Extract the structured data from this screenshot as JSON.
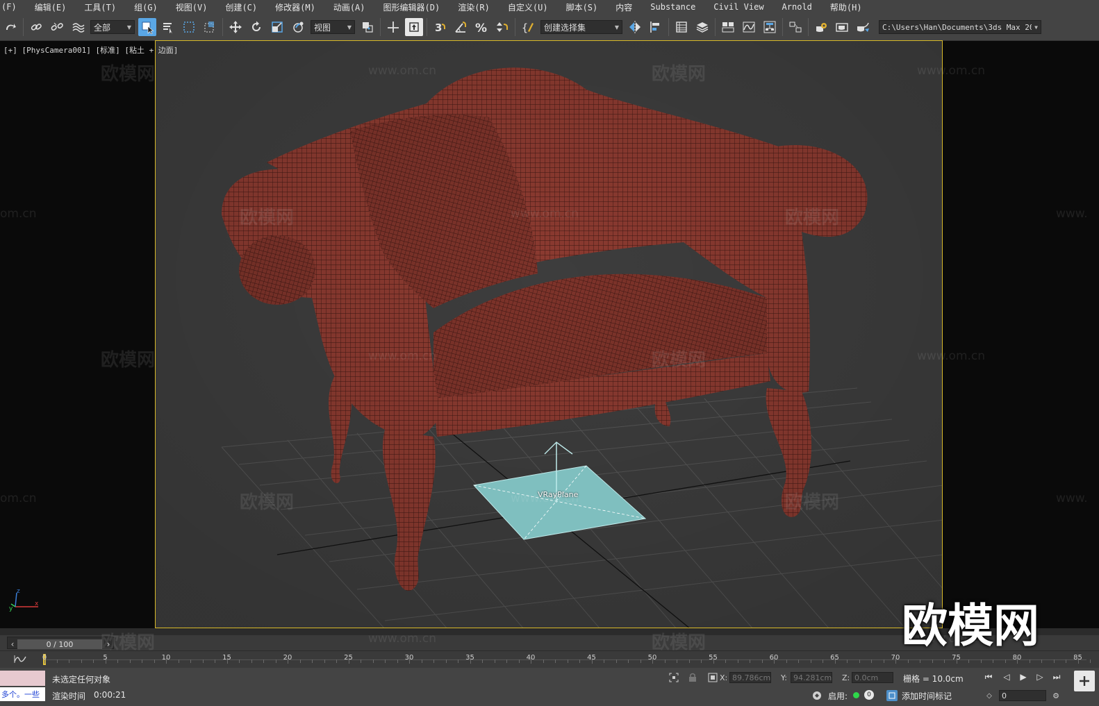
{
  "menu": [
    "(F)",
    "编辑(E)",
    "工具(T)",
    "组(G)",
    "视图(V)",
    "创建(C)",
    "修改器(M)",
    "动画(A)",
    "图形编辑器(D)",
    "渲染(R)",
    "自定义(U)",
    "脚本(S)",
    "内容",
    "Substance",
    "Civil View",
    "Arnold",
    "帮助(H)"
  ],
  "toolbar": {
    "selection_filter": "全部",
    "ref_coord": "视图",
    "named_selection": "创建选择集",
    "path": "C:\\Users\\Han\\Documents\\3ds Max 2022"
  },
  "icons": {
    "redo": "redo-icon",
    "link": "link-icon",
    "unlink": "unlink-icon",
    "bind": "bind-space-warp-icon",
    "select": "select-object-icon",
    "select_name": "select-by-name-icon",
    "rect_region": "rect-selection-region-icon",
    "window_crossing": "window-crossing-icon",
    "move": "select-move-icon",
    "rotate": "select-rotate-icon",
    "scale": "select-scale-icon",
    "place": "select-place-icon",
    "pivot": "use-pivot-icon",
    "manipulate": "manipulate-icon",
    "keyboard": "keyboard-shortcut-icon",
    "snap": "snaps-toggle-icon",
    "angle_snap": "angle-snap-icon",
    "percent_snap": "percent-snap-icon",
    "spinner_snap": "spinner-snap-icon",
    "edit_named": "edit-named-selection-icon",
    "mirror": "mirror-icon",
    "align": "align-icon",
    "scene_explorer": "scene-explorer-icon",
    "layer": "layer-explorer-icon",
    "ribbon": "ribbon-icon",
    "curve": "curve-editor-icon",
    "schematic": "schematic-view-icon",
    "material": "material-editor-icon",
    "render_setup": "render-setup-icon",
    "render_frame": "rendered-frame-icon",
    "render": "render-production-icon"
  },
  "viewport": {
    "label": "[+] [PhysCamera001] [标准] [粘土 + 边面]",
    "object_label": "VRayPlane",
    "colors": {
      "sofa": "#8b3a30",
      "wire": "#3a1612",
      "plane": "#7fbfbf",
      "grid": "#555555",
      "border": "#d8b928"
    }
  },
  "watermarks": {
    "text": "欧模网",
    "url": "www.om.cn",
    "url_partial": "om.cn",
    "url_cut": "www.",
    "logo": "欧模网"
  },
  "time_slider": {
    "value": "0 / 100",
    "prev": "‹",
    "next": "›"
  },
  "track_ticks": [
    "0",
    "5",
    "10",
    "15",
    "20",
    "25",
    "30",
    "35",
    "40",
    "45",
    "50",
    "55",
    "60",
    "65",
    "70",
    "75",
    "80",
    "85"
  ],
  "status": {
    "message": "未选定任何对象",
    "render_time_label": "渲染时间",
    "render_time": "0:00:21",
    "maxscript": "多个。一些",
    "x_label": "X:",
    "x_value": "89.786cm",
    "y_label": "Y:",
    "y_value": "94.281cm",
    "z_label": "Z:",
    "z_value": "0.0cm",
    "grid": "栅格 = 10.0cm",
    "enable_label": "启用:",
    "enable_value": "0",
    "add_time_tag": "添加时间标记",
    "frame_value": "0"
  }
}
